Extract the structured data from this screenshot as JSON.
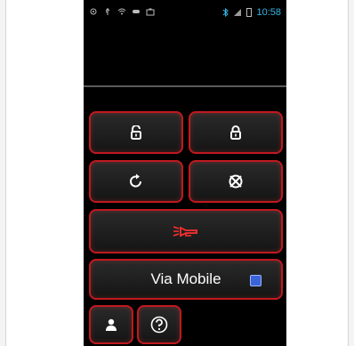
{
  "status_bar": {
    "time": "10:58",
    "left_icons": [
      "gps-icon",
      "usb-icon",
      "wifi-icon",
      "gamepad-icon",
      "briefcase-icon"
    ],
    "right_icons": [
      "bluetooth-icon",
      "signal-icon",
      "battery-icon"
    ]
  },
  "controls": {
    "unlock_icon": "unlock-icon",
    "lock_icon": "lock-icon",
    "remote_start_icon": "remote-start-icon",
    "stop_icon": "stop-icon",
    "horn_icon": "horn-icon",
    "mode_label": "Via Mobile",
    "mode_indicator_color": "#3a64d8",
    "user_icon": "user-icon",
    "help_icon": "help-icon"
  },
  "colors": {
    "accent_red": "#c0191f",
    "accent_blue": "#33b5e5"
  }
}
